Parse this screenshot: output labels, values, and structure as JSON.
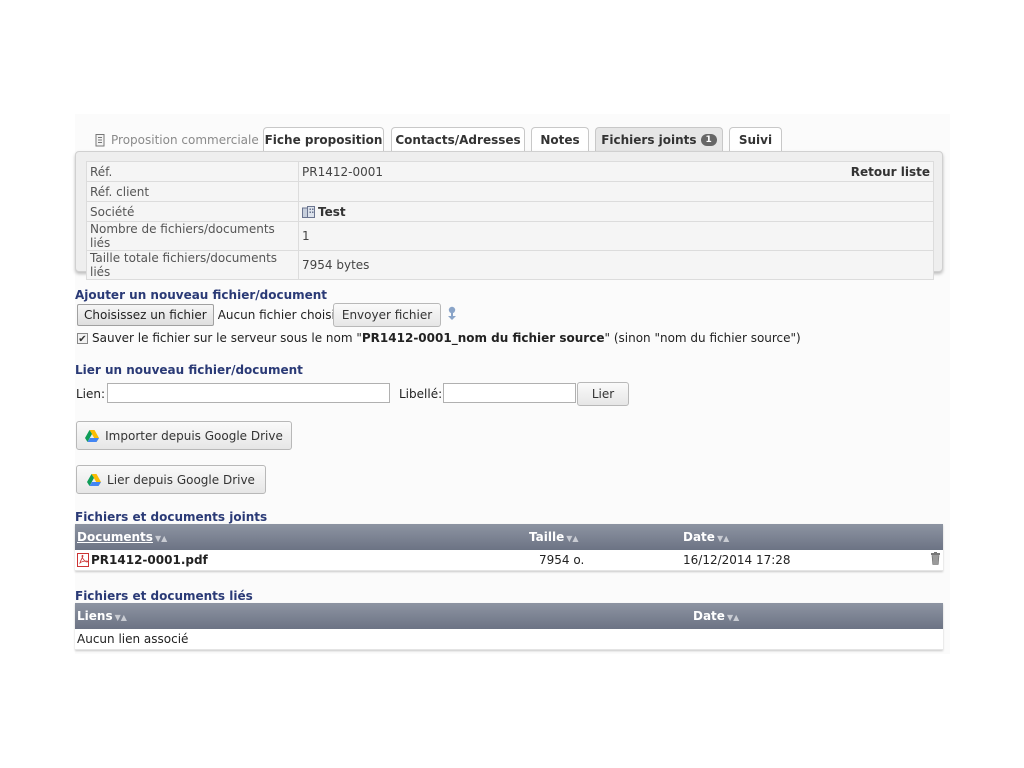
{
  "tabs": {
    "first_label": "Proposition commerciale",
    "items": [
      "Fiche proposition",
      "Contacts/Adresses",
      "Notes",
      "Fichiers joints",
      "Suivi"
    ],
    "files_badge": "1"
  },
  "info": {
    "ref_label": "Réf.",
    "ref_value": "PR1412-0001",
    "back_label": "Retour liste",
    "client_ref_label": "Réf. client",
    "client_ref_value": "",
    "company_label": "Société",
    "company_value": "Test",
    "nb_files_label": "Nombre de fichiers/documents liés",
    "nb_files_value": "1",
    "total_size_label": "Taille totale fichiers/documents liés",
    "total_size_value": "7954 bytes"
  },
  "upload": {
    "title": "Ajouter un nouveau fichier/document",
    "choose_label": "Choisissez un fichier",
    "no_file_text": "Aucun fichier choisi",
    "send_label": "Envoyer fichier",
    "save_text_before": "Sauver le fichier sur le serveur sous le nom \"",
    "save_text_bold": "PR1412-0001_nom du fichier source",
    "save_text_after": "\" (sinon \"nom du fichier source\")"
  },
  "link": {
    "title": "Lier un nouveau fichier/document",
    "link_label": "Lien:",
    "title_label": "Libellé:",
    "submit_label": "Lier"
  },
  "drive": {
    "import_label": "Importer depuis Google Drive",
    "link_label": "Lier depuis Google Drive"
  },
  "attached": {
    "title": "Fichiers et documents joints",
    "headers": {
      "documents": "Documents",
      "size": "Taille",
      "date": "Date"
    },
    "rows": [
      {
        "name": "PR1412-0001.pdf",
        "size": "7954 o.",
        "date": "16/12/2014 17:28"
      }
    ]
  },
  "linked": {
    "title": "Fichiers et documents liés",
    "headers": {
      "links": "Liens",
      "date": "Date"
    },
    "empty_text": "Aucun lien associé"
  },
  "colors": {
    "section_title": "#2a3a76",
    "header_bg": "#7a8191"
  }
}
